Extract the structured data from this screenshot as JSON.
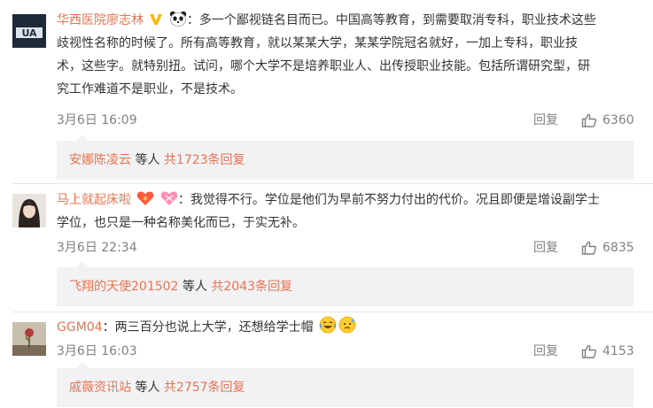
{
  "comments": [
    {
      "username": "华西医院廖志林",
      "separator": "：",
      "text_lines": [
        "多一个鄙视链名目而已。中国高等教育，到需要取消专科，职业技术这些",
        "歧视性名称的时候了。所有高等教育，就以某某大学，某某学院冠名就好，一加上专科，职业技",
        "术，这些字。就特别扭。试问，哪个大学不是培养职业人、出传授职业技能。包括所谓研究型，研",
        "究工作难道不是职业，不是技术。"
      ],
      "time": "3月6日 16:09",
      "reply_label": "回复",
      "like_count": "6360",
      "reply_preview": {
        "user": "安娜陈凌云",
        "mid": " 等人 ",
        "total": "共1723条回复"
      }
    },
    {
      "username": "马上就起床啦",
      "separator": "：",
      "text_lines": [
        "我觉得不行。学位是他们为早前不努力付出的代价。况且即便是增设副学士",
        "学位，也只是一种名称美化而已，于实无补。"
      ],
      "time": "3月6日 22:34",
      "reply_label": "回复",
      "like_count": "6835",
      "reply_preview": {
        "user": "飞翔的天使201502",
        "mid": " 等人 ",
        "total": "共2043条回复"
      }
    },
    {
      "username": "GGM04",
      "separator": "：",
      "text_lines": [
        "两三百分也说上大学，还想给学士帽"
      ],
      "time": "3月6日 16:03",
      "reply_label": "回复",
      "like_count": "4153",
      "reply_preview": {
        "user": "戚薇资讯站",
        "mid": " 等人 ",
        "total": "共2757条回复"
      }
    }
  ],
  "colors": {
    "username": "#eb7350",
    "text": "#333333",
    "meta": "#808080",
    "reply_box_bg": "#f2f2f5",
    "verified_badge": "#ffb400"
  },
  "icons": {
    "verified": "verified-v-icon",
    "panda": "panda-icon",
    "vip_heart": "vip-heart-icon",
    "like": "thumbs-up-icon",
    "laugh_cry": "laugh-cry-emoji-icon",
    "sweat": "sweat-emoji-icon"
  }
}
